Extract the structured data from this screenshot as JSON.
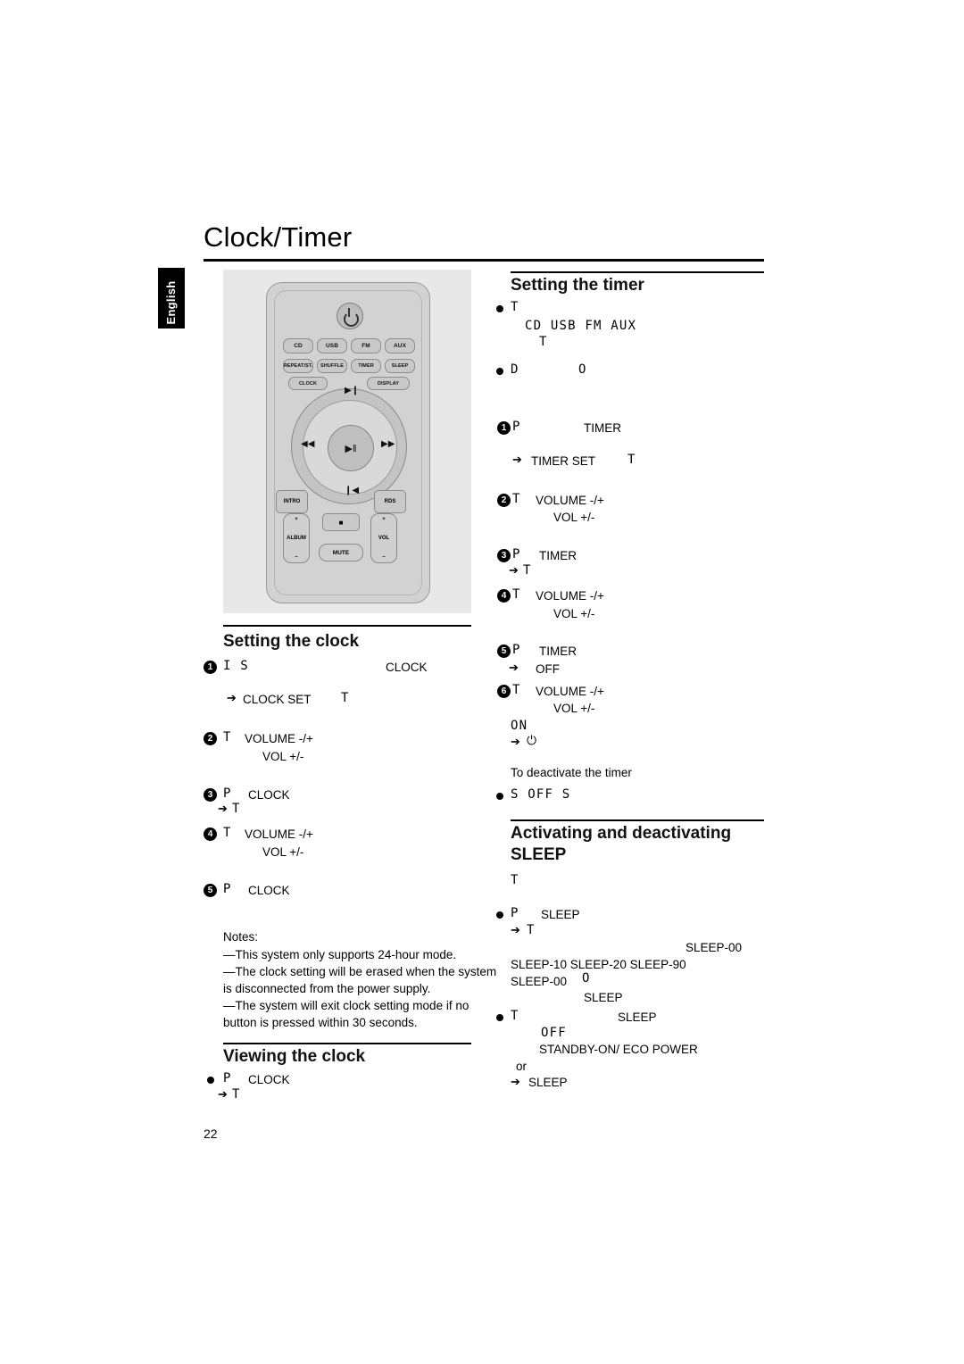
{
  "page": {
    "title": "Clock/Timer",
    "language_tab": "English",
    "page_number": "22"
  },
  "remote": {
    "keys": [
      {
        "label": "CD"
      },
      {
        "label": "USB"
      },
      {
        "label": "FM"
      },
      {
        "label": "AUX"
      },
      {
        "label": "REPEAT/ST."
      },
      {
        "label": "SHUFFLE"
      },
      {
        "label": "TIMER"
      },
      {
        "label": "SLEEP"
      },
      {
        "label": "CLOCK"
      },
      {
        "label": "DISPLAY"
      },
      {
        "label": "INTRO"
      },
      {
        "label": "RDS"
      },
      {
        "label": "ALBUM"
      },
      {
        "label": "VOL"
      },
      {
        "label": "MUTE"
      }
    ]
  },
  "setting_clock": {
    "heading": "Setting the clock",
    "steps": [
      {
        "n": "1",
        "lcd": "I S",
        "text": "CLOCK",
        "sub_arrow": "CLOCK SET",
        "sub_lcd": "T"
      },
      {
        "n": "2",
        "lcd": "T",
        "text": "VOLUME -/+",
        "line2": "VOL +/-"
      },
      {
        "n": "3",
        "lcd": "P",
        "text": "CLOCK",
        "sub_lcd": "T"
      },
      {
        "n": "4",
        "lcd": "T",
        "text": "VOLUME -/+",
        "line2": "VOL +/-"
      },
      {
        "n": "5",
        "lcd": "P",
        "text": "CLOCK"
      }
    ],
    "notes_heading": "Notes:",
    "notes": [
      "—This system only supports 24-hour mode.",
      "—The clock setting will be erased when the system",
      "is disconnected from the power supply.",
      "—The system will exit clock setting mode if no",
      "button is pressed within 30 seconds."
    ]
  },
  "viewing_clock": {
    "heading": "Viewing the clock",
    "bullet_lcd": "P",
    "bullet_text": "CLOCK",
    "sub_lcd": "T"
  },
  "setting_timer": {
    "heading": "Setting the timer",
    "bullets": [
      {
        "lcd": "T"
      },
      {
        "lcd2": "CD USB FM AUX",
        "lcd3": "T"
      },
      {
        "lcd": "D",
        "lcd_b": "O"
      }
    ],
    "steps": [
      {
        "n": "1",
        "lcd": "P",
        "text": "TIMER",
        "sub_arrow": "TIMER SET",
        "sub_lcd": "T"
      },
      {
        "n": "2",
        "lcd": "T",
        "text": "VOLUME -/+",
        "line2": "VOL +/-"
      },
      {
        "n": "3",
        "lcd": "P",
        "text": "TIMER",
        "sub_lcd": "T"
      },
      {
        "n": "4",
        "lcd": "T",
        "text": "VOLUME -/+",
        "line2": "VOL +/-"
      },
      {
        "n": "5",
        "lcd": "P",
        "text": "TIMER",
        "sub_arrow": "OFF"
      },
      {
        "n": "6",
        "lcd": "T",
        "text": "VOLUME -/+",
        "line2": "VOL +/-",
        "lcd_on": "ON",
        "arrow_sym": "⏻"
      }
    ],
    "deactivate_text": "To   deactivate the timer",
    "deactivate_lcd": "S OFF S"
  },
  "sleep": {
    "heading_line1": "Activating and deactivating",
    "heading_line2": "SLEEP",
    "intro_lcd": "T",
    "bullet1_lcd": "P",
    "bullet1_text": "SLEEP",
    "bullet1_sub_lcd": "T",
    "options_right": "SLEEP-00",
    "options_row": "SLEEP-10  SLEEP-20     SLEEP-90",
    "options_row2_a": "SLEEP-00",
    "options_row2_lcd": "O",
    "options_row2_b": "SLEEP",
    "bullet2_lcd": "T",
    "bullet2_text": "SLEEP",
    "bullet2_lcd_off": "OFF",
    "bullet2_line2": "STANDBY-ON/ ECO POWER",
    "or_text": "or",
    "last_arrow_text": "SLEEP"
  }
}
